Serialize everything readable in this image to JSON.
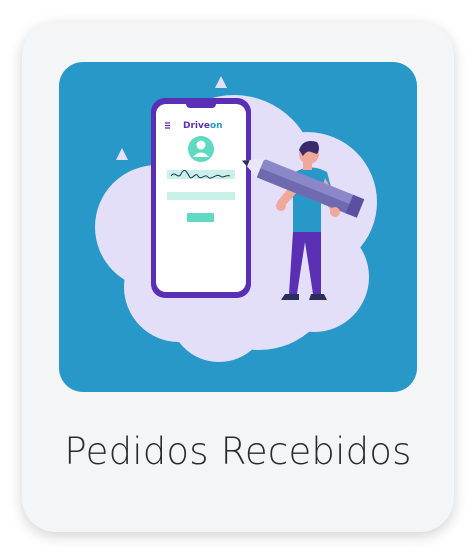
{
  "card": {
    "label": "Pedidos Recebidos",
    "illustration": "signing-contract-on-phone-illustration"
  },
  "phone": {
    "brand_prefix": "Drive",
    "brand_suffix": "on",
    "menu_icon": "hamburger-icon"
  },
  "colors": {
    "card_background": "#f4f5f7",
    "hero_background": "#2798c7",
    "cloud": "#e3dff8",
    "phone_frame": "#5a2fb3",
    "accent_green": "#5fd9c1",
    "caption_text": "#2a2a2a"
  }
}
